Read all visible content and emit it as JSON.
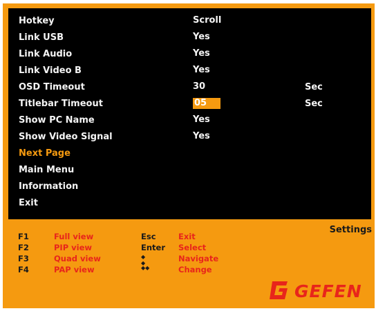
{
  "menu": {
    "rows": [
      {
        "label": "Hotkey",
        "value": "Scroll",
        "unit": ""
      },
      {
        "label": "Link USB",
        "value": "Yes",
        "unit": ""
      },
      {
        "label": "Link Audio",
        "value": "Yes",
        "unit": ""
      },
      {
        "label": "Link Video B",
        "value": "Yes",
        "unit": ""
      },
      {
        "label": "OSD Timeout",
        "value": "30",
        "unit": "Sec"
      },
      {
        "label": "Titlebar Timeout",
        "value": "05",
        "unit": "Sec"
      },
      {
        "label": "Show PC Name",
        "value": "Yes",
        "unit": ""
      },
      {
        "label": "Show Video Signal",
        "value": "Yes",
        "unit": ""
      }
    ],
    "nav": [
      {
        "label": "Next Page"
      },
      {
        "label": "Main Menu"
      },
      {
        "label": "Information"
      },
      {
        "label": "Exit"
      }
    ]
  },
  "panel_title": "Settings",
  "legend": {
    "fkeys": [
      {
        "key": "F1",
        "action": "Full view"
      },
      {
        "key": "F2",
        "action": "PIP view"
      },
      {
        "key": "F3",
        "action": "Quad view"
      },
      {
        "key": "F4",
        "action": "PAP view"
      }
    ],
    "controls": [
      {
        "key": "Esc",
        "action": "Exit"
      },
      {
        "key": "Enter",
        "action": "Select"
      },
      {
        "key": "◆ ◆",
        "action": "Navigate"
      },
      {
        "key": "◆◆",
        "action": "Change"
      }
    ]
  },
  "brand": {
    "name": "GEFEN",
    "color": "#e8251b"
  },
  "colors": {
    "accent": "#f59a10",
    "osd_bg": "#000000",
    "text": "#f4f4f4",
    "action": "#e8251b"
  }
}
